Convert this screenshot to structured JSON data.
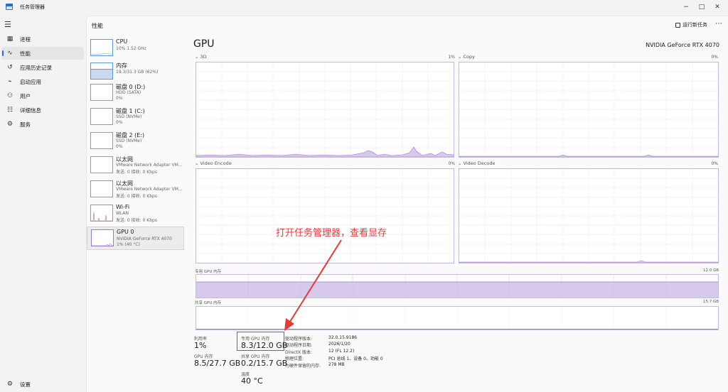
{
  "window": {
    "title": "任务管理器",
    "controls": {
      "minimize": "−",
      "maximize": "□",
      "close": "✕"
    }
  },
  "nav": {
    "items": [
      {
        "label": "进程",
        "icon": "processes-icon"
      },
      {
        "label": "性能",
        "icon": "performance-icon",
        "active": true
      },
      {
        "label": "应用历史记录",
        "icon": "history-icon"
      },
      {
        "label": "启动应用",
        "icon": "startup-icon"
      },
      {
        "label": "用户",
        "icon": "users-icon"
      },
      {
        "label": "详细信息",
        "icon": "details-icon"
      },
      {
        "label": "服务",
        "icon": "services-icon"
      }
    ],
    "settings": "设置"
  },
  "header": {
    "title": "性能",
    "run_task": "运行新任务",
    "more": "⋯"
  },
  "devices": [
    {
      "name": "CPU",
      "sub1": "10% 1.52 GHz",
      "sub2": ""
    },
    {
      "name": "内存",
      "sub1": "19.3/31.3 GB (62%)",
      "sub2": ""
    },
    {
      "name": "磁盘 0 (D:)",
      "sub1": "HDD (SATA)",
      "sub2": "0%"
    },
    {
      "name": "磁盘 1 (C:)",
      "sub1": "SSD (NVMe)",
      "sub2": "0%"
    },
    {
      "name": "磁盘 2 (E:)",
      "sub1": "SSD (NVMe)",
      "sub2": "0%"
    },
    {
      "name": "以太网",
      "sub1": "VMware Network Adapter VM...",
      "sub2": "发送: 0 接收: 0 Kbps"
    },
    {
      "name": "以太网",
      "sub1": "VMware Network Adapter VM...",
      "sub2": "发送: 0 接收: 0 Kbps"
    },
    {
      "name": "Wi-Fi",
      "sub1": "WLAN",
      "sub2": "发送: 0 接收: 0 Kbps"
    },
    {
      "name": "GPU 0",
      "sub1": "NVIDIA GeForce RTX 4070",
      "sub2": "1% (40 °C)"
    }
  ],
  "gpu": {
    "title": "GPU",
    "model": "NVIDIA GeForce RTX 4070",
    "graphs": [
      {
        "label": "3D",
        "pct": "1%"
      },
      {
        "label": "Copy",
        "pct": "0%"
      },
      {
        "label": "Video Encode",
        "pct": "0%"
      },
      {
        "label": "Video Decode",
        "pct": "0%"
      }
    ],
    "dedicated_mem": {
      "label": "专用 GPU 内存",
      "max": "12.0 GB"
    },
    "shared_mem": {
      "label": "共享 GPU 内存",
      "max": "15.7 GB"
    },
    "stats": {
      "utilization_label": "利用率",
      "utilization": "1%",
      "dedicated_label": "专用 GPU 内存",
      "dedicated": "8.3/12.0 GB",
      "gpu_mem_label": "GPU 内存",
      "gpu_mem": "8.5/27.7 GB",
      "shared_label": "共享 GPU 内存",
      "shared": "0.2/15.7 GB",
      "temp_label": "温度",
      "temp": "40 °C"
    },
    "info": [
      {
        "k": "驱动程序版本:",
        "v": "32.0.15.9186"
      },
      {
        "k": "驱动程序日期:",
        "v": "2026/1/20"
      },
      {
        "k": "DirectX 版本:",
        "v": "12 (FL 12.2)"
      },
      {
        "k": "物理位置:",
        "v": "PCI 总线 1、设备 0、功能 0"
      },
      {
        "k": "为硬件保留的内存:",
        "v": "278 MB"
      }
    ]
  },
  "annotation": "打开任务管理器，查看显存",
  "colors": {
    "accent": "#1e6fd9",
    "gpu_line": "#9a7bc9",
    "gpu_fill": "#d7c8ee",
    "annotation": "#e53935"
  }
}
